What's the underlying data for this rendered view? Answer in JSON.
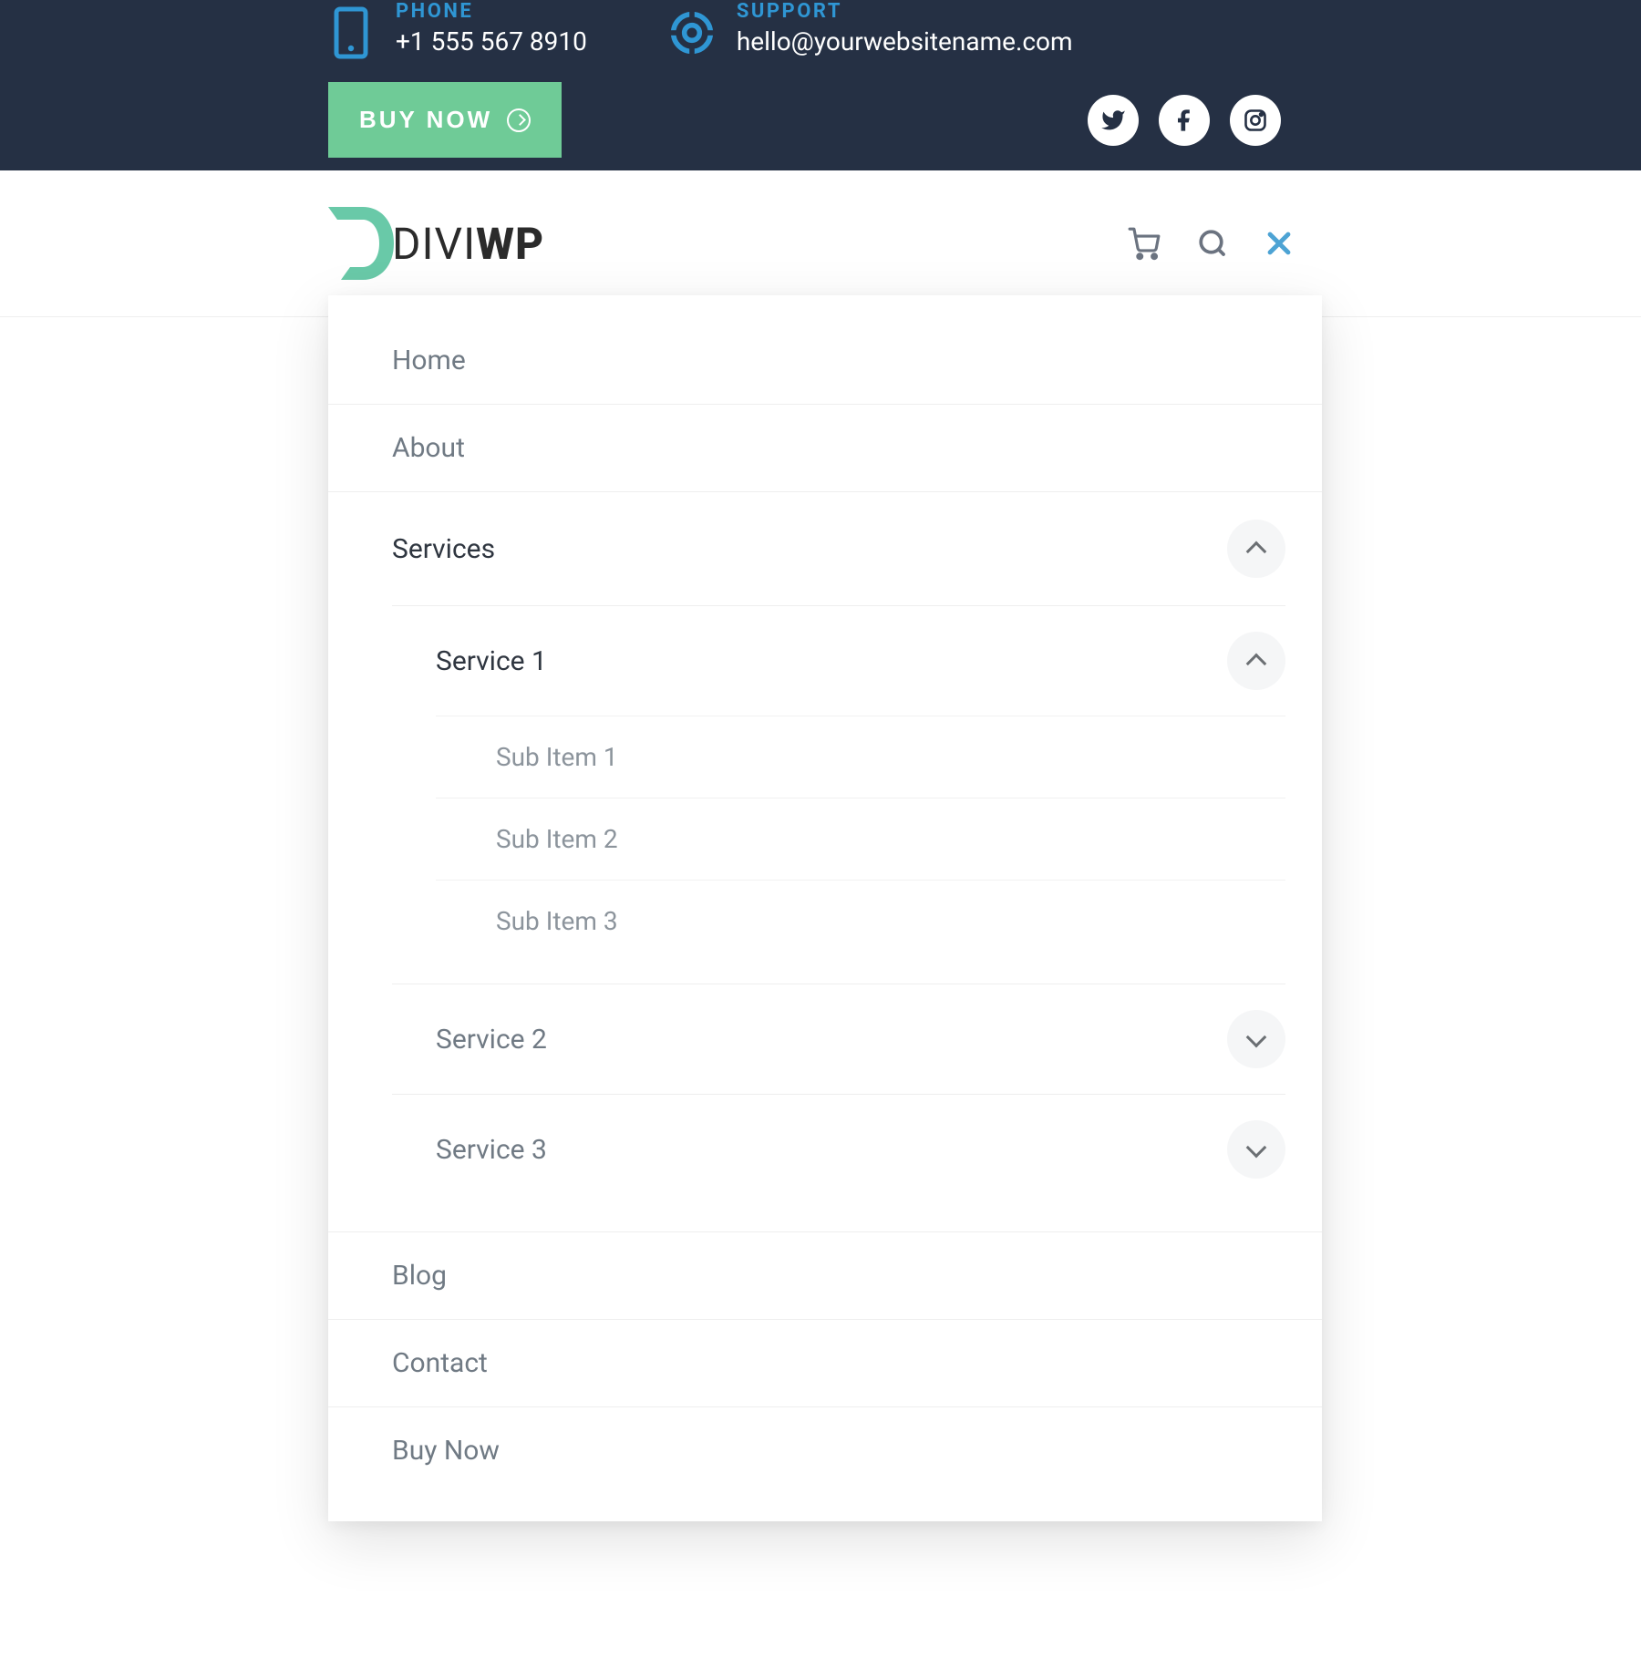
{
  "topbar": {
    "phone_label": "PHONE",
    "phone_value": "+1 555 567 8910",
    "support_label": "SUPPORT",
    "support_value": "hello@yourwebsitename.com",
    "buy_button": "BUY NOW"
  },
  "logo": {
    "part1": "DIVI",
    "part2": "WP"
  },
  "menu": {
    "home": "Home",
    "about": "About",
    "services": "Services",
    "service1": "Service 1",
    "sub1": "Sub Item 1",
    "sub2": "Sub Item 2",
    "sub3": "Sub Item 3",
    "service2": "Service 2",
    "service3": "Service 3",
    "blog": "Blog",
    "contact": "Contact",
    "buynow": "Buy Now"
  }
}
